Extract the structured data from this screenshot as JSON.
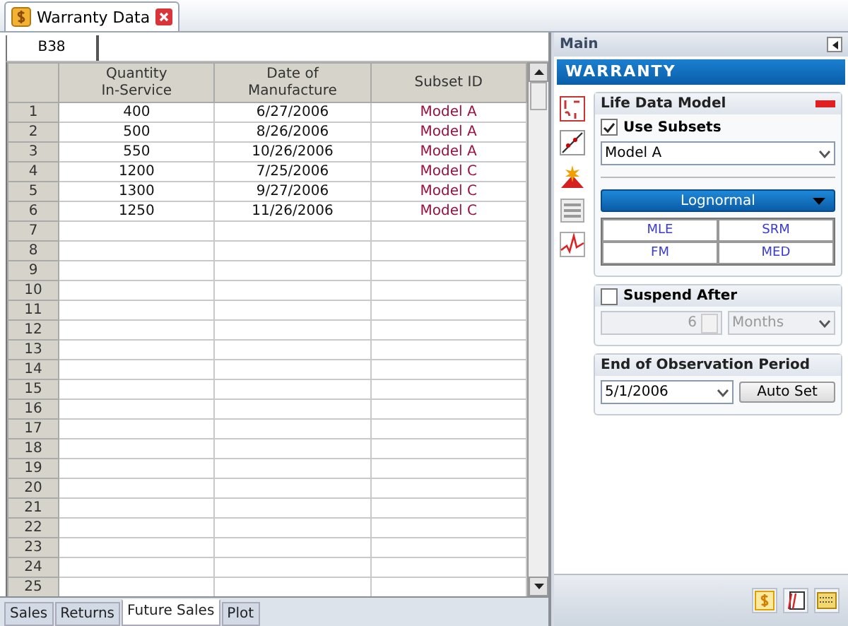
{
  "document_tab": {
    "title": "Warranty Data"
  },
  "cell_reference": "B38",
  "table": {
    "columns": [
      "Quantity\nIn-Service",
      "Date of\nManufacture",
      "Subset ID"
    ],
    "rows": [
      {
        "number": "1",
        "cells": [
          "400",
          "6/27/2006",
          "Model A"
        ]
      },
      {
        "number": "2",
        "cells": [
          "500",
          "8/26/2006",
          "Model A"
        ]
      },
      {
        "number": "3",
        "cells": [
          "550",
          "10/26/2006",
          "Model A"
        ]
      },
      {
        "number": "4",
        "cells": [
          "1200",
          "7/25/2006",
          "Model C"
        ]
      },
      {
        "number": "5",
        "cells": [
          "1300",
          "9/27/2006",
          "Model C"
        ]
      },
      {
        "number": "6",
        "cells": [
          "1250",
          "11/26/2006",
          "Model C"
        ]
      }
    ],
    "empty_rows": [
      "7",
      "8",
      "9",
      "10",
      "11",
      "12",
      "13",
      "14",
      "15",
      "16",
      "17",
      "18",
      "19",
      "20",
      "21",
      "22",
      "23",
      "24",
      "25"
    ]
  },
  "sheet_tabs": [
    {
      "label": "Sales",
      "selected": false
    },
    {
      "label": "Returns",
      "selected": false
    },
    {
      "label": "Future Sales",
      "selected": true
    },
    {
      "label": "Plot",
      "selected": false
    }
  ],
  "panel": {
    "title": "Main",
    "banner": "WARRANTY",
    "life_data_model": {
      "title": "Life Data Model",
      "use_subsets": {
        "label": "Use Subsets",
        "checked": true
      },
      "subset": "Model A",
      "distribution": "Lognormal",
      "methods": [
        "MLE",
        "SRM",
        "FM",
        "MED"
      ]
    },
    "suspend_after": {
      "label": "Suspend After",
      "checked": false,
      "value": "6",
      "unit": "Months"
    },
    "end_of_observation": {
      "title": "End of Observation Period",
      "date": "5/1/2006",
      "button": "Auto Set"
    }
  }
}
